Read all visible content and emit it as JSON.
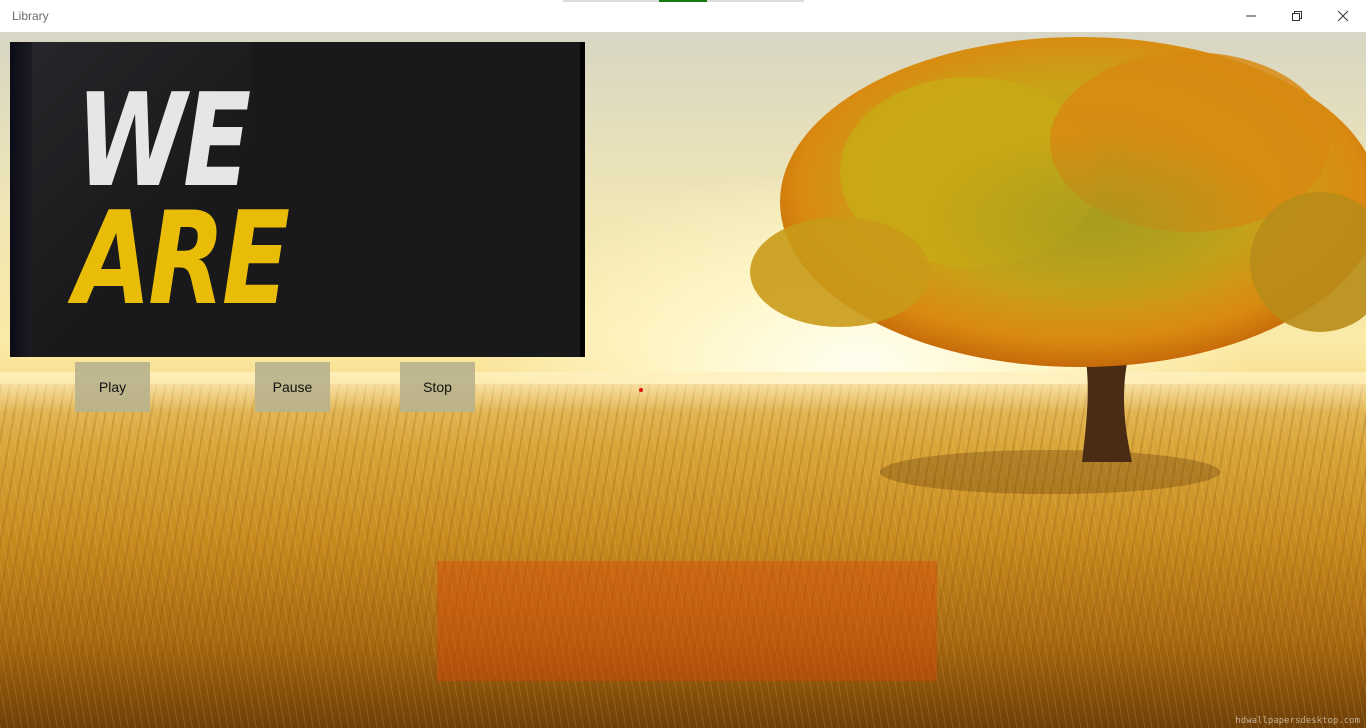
{
  "window": {
    "title": "Library",
    "controls": {
      "minimize_icon": "minimize-icon",
      "restore_icon": "restore-icon",
      "close_icon": "close-icon"
    }
  },
  "media": {
    "line1": "WE",
    "line2": "ARE",
    "colors": {
      "background": "#19191b",
      "line1": "#e6e6e6",
      "line2": "#e9bd07"
    }
  },
  "controls": {
    "play_label": "Play",
    "pause_label": "Pause",
    "stop_label": "Stop"
  },
  "overlay": {
    "color": "#dc460a"
  },
  "background": {
    "watermark": "hdwallpapersdesktop.com"
  },
  "colors": {
    "button": "#b9b28c",
    "accent": "#107c10"
  }
}
